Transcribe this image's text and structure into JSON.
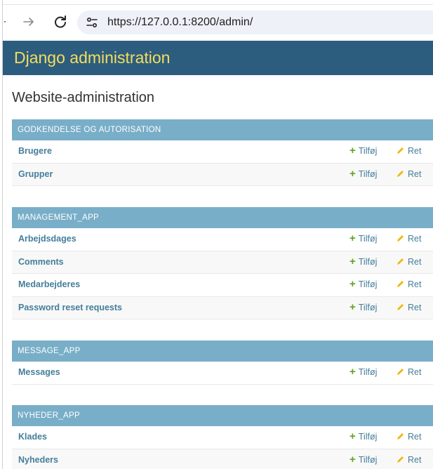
{
  "browser": {
    "url": "https://127.0.0.1:8200/admin/"
  },
  "header": {
    "branding": "Django administration"
  },
  "content": {
    "title": "Website-administration"
  },
  "actions": {
    "add_label": "Tilføj",
    "change_label": "Ret"
  },
  "modules": [
    {
      "caption": "GODKENDELSE OG AUTORISATION",
      "models": [
        "Brugere",
        "Grupper"
      ]
    },
    {
      "caption": "MANAGEMENT_APP",
      "models": [
        "Arbejdsdages",
        "Comments",
        "Medarbejderes",
        "Password reset requests"
      ]
    },
    {
      "caption": "MESSAGE_APP",
      "models": [
        "Messages"
      ]
    },
    {
      "caption": "NYHEDER_APP",
      "models": [
        "Klades",
        "Nyheders"
      ]
    }
  ],
  "colors": {
    "header_bg": "#2c5d7f",
    "branding_text": "#f5dd5d",
    "module_caption_bg": "#79aec8",
    "link": "#447e9b",
    "add_icon": "#5fa225",
    "change_icon": "#efb80b"
  },
  "icons": {
    "forward": "arrow-right-icon",
    "reload": "reload-icon",
    "site_info": "tune-icon",
    "add": "plus-icon",
    "change": "pencil-icon"
  }
}
